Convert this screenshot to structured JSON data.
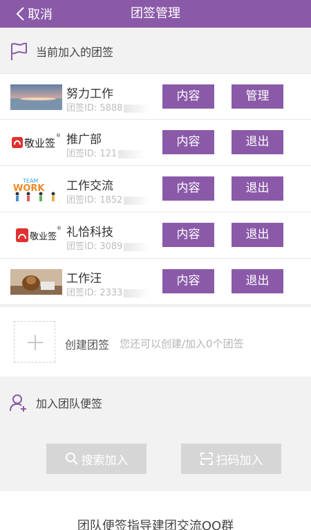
{
  "header": {
    "back_label": "取消",
    "title": "团签管理"
  },
  "current_section": {
    "label": "当前加入的团签",
    "icon": "flag-icon"
  },
  "teams": [
    {
      "name": "努力工作",
      "id_text": "团签ID: 5888",
      "thumb": "sunset-photo",
      "btn1": "内容",
      "btn2": "管理"
    },
    {
      "name": "推广部",
      "id_text": "团签ID: 121",
      "thumb": "jingyeqian-logo",
      "btn1": "内容",
      "btn2": "退出"
    },
    {
      "name": "工作交流",
      "id_text": "团签ID: 1852",
      "thumb": "teamwork-image",
      "btn1": "内容",
      "btn2": "退出"
    },
    {
      "name": "礼恰科技",
      "id_text": "团签ID: 3089",
      "thumb": "jingyeqian-logo",
      "btn1": "内容",
      "btn2": "退出"
    },
    {
      "name": "工作汪",
      "id_text": "团签ID: 2333",
      "thumb": "dog-photo",
      "btn1": "内容",
      "btn2": "退出"
    }
  ],
  "logo_text": "敬业签",
  "teamwork_text": {
    "top": "TEAM",
    "bottom": "WORK"
  },
  "create": {
    "label": "创建团签",
    "hint": "您还可以创建/加入0个团签"
  },
  "join_section": {
    "label": "加入团队便签",
    "icon": "add-user-icon"
  },
  "actions": {
    "search_label": "搜索加入",
    "scan_label": "扫码加入"
  },
  "bottom_text": "团队便签指导建团交流QQ群",
  "colors": {
    "accent": "#8a5aa8",
    "disabled": "#d6d6d6"
  }
}
